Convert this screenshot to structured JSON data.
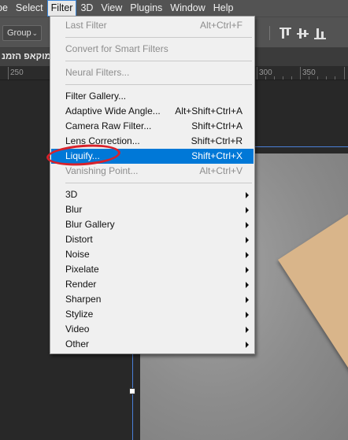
{
  "menubar": {
    "items": [
      {
        "label": "pe",
        "active": false
      },
      {
        "label": "Select",
        "active": false
      },
      {
        "label": "Filter",
        "active": true
      },
      {
        "label": "3D",
        "active": false
      },
      {
        "label": "View",
        "active": false
      },
      {
        "label": "Plugins",
        "active": false
      },
      {
        "label": "Window",
        "active": false
      },
      {
        "label": "Help",
        "active": false
      }
    ]
  },
  "options_bar": {
    "auto_select_value": "Group",
    "align_icons": [
      "align-top-edges-icon",
      "align-vertical-centers-icon",
      "align-bottom-edges-icon"
    ]
  },
  "document": {
    "tab_title": "מוקאפ הזמנ"
  },
  "ruler": {
    "labels": [
      "250",
      "300",
      "350"
    ]
  },
  "filter_menu": {
    "last_filter": {
      "label": "Last Filter",
      "shortcut": "Alt+Ctrl+F"
    },
    "convert_smart": {
      "label": "Convert for Smart Filters"
    },
    "neural_filters": {
      "label": "Neural Filters..."
    },
    "filter_gallery": {
      "label": "Filter Gallery..."
    },
    "adaptive_wide_angle": {
      "label": "Adaptive Wide Angle...",
      "shortcut": "Alt+Shift+Ctrl+A"
    },
    "camera_raw": {
      "label": "Camera Raw Filter...",
      "shortcut": "Shift+Ctrl+A"
    },
    "lens_correction": {
      "label": "Lens Correction...",
      "shortcut": "Shift+Ctrl+R"
    },
    "liquify": {
      "label": "Liquify...",
      "shortcut": "Shift+Ctrl+X"
    },
    "vanishing_point": {
      "label": "Vanishing Point...",
      "shortcut": "Alt+Ctrl+V"
    },
    "submenus": [
      "3D",
      "Blur",
      "Blur Gallery",
      "Distort",
      "Noise",
      "Pixelate",
      "Render",
      "Sharpen",
      "Stylize",
      "Video",
      "Other"
    ]
  },
  "colors": {
    "highlight": "#0078d7",
    "annotation_circle": "#d8212a",
    "guide": "#4a7fd8"
  }
}
